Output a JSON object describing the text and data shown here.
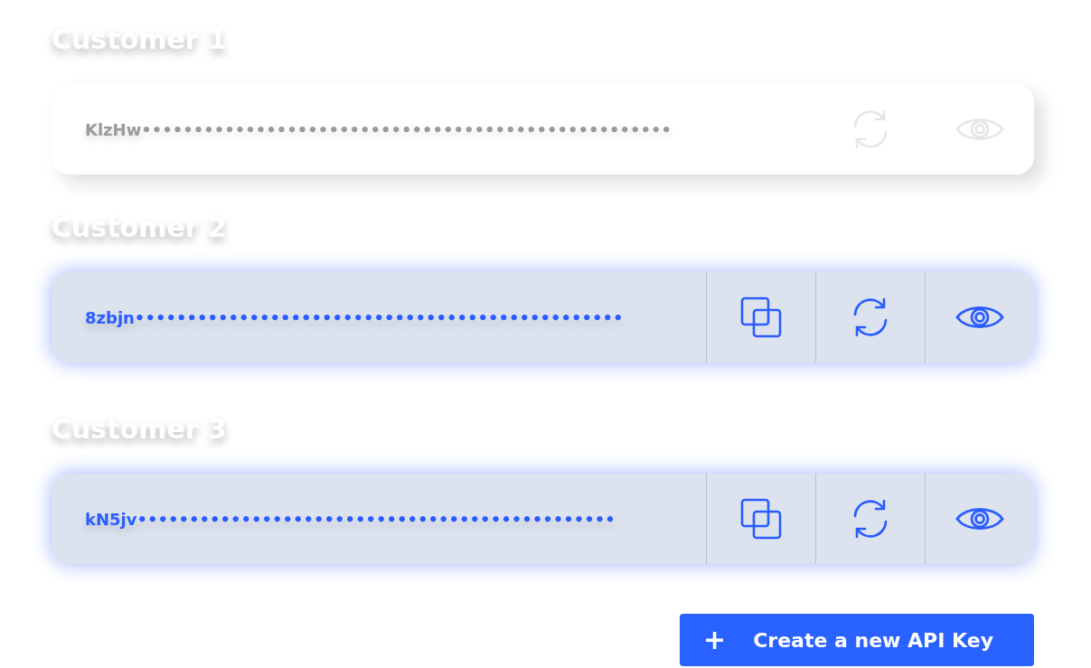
{
  "customers": [
    {
      "label": "Customer 1",
      "key": "KlzHw•••••••••••••••••••••••••••••••••••••••••••••••••••",
      "active": false
    },
    {
      "label": "Customer 2",
      "key": "8zbjn•••••••••••••••••••••••••••••••••••••••••••••••",
      "active": true
    },
    {
      "label": "Customer 3",
      "key": "kN5jv••••••••••••••••••••••••••••••••••••••••••••••",
      "active": true
    }
  ],
  "create_button": {
    "icon": "+",
    "label": "Create a new API Key"
  }
}
